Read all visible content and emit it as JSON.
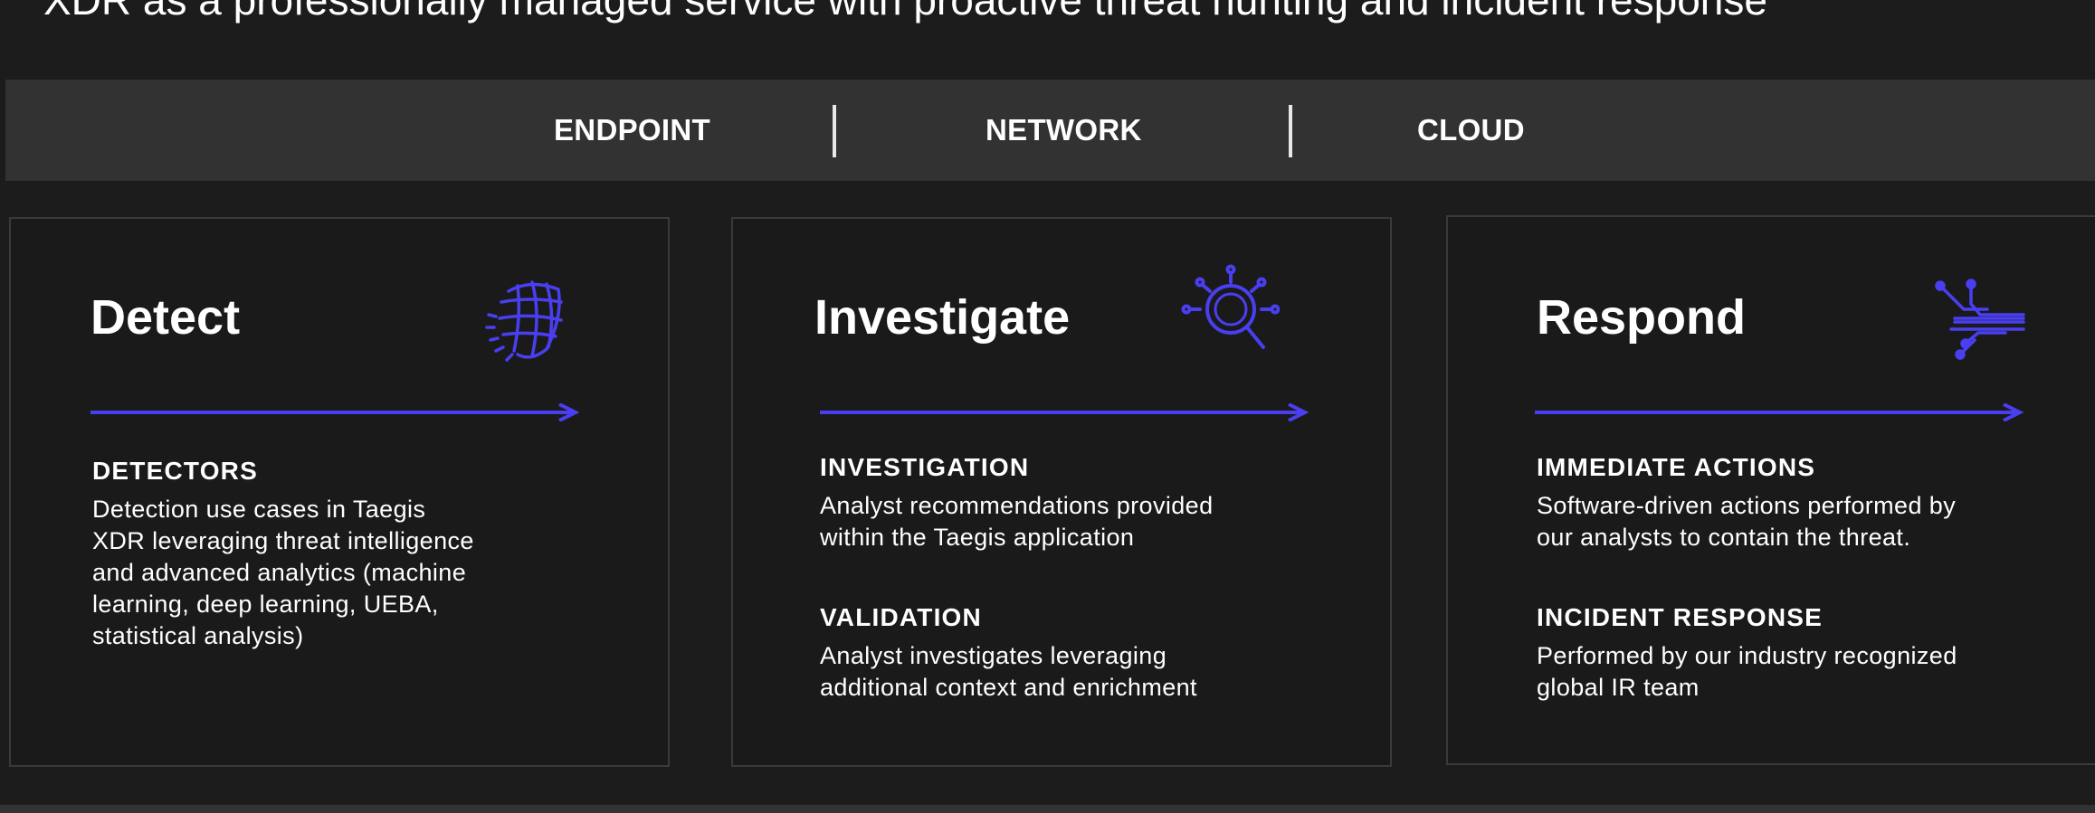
{
  "headline": "XDR as a professionally managed service with proactive threat hunting and incident response",
  "coverage": {
    "items": [
      "ENDPOINT",
      "NETWORK",
      "CLOUD"
    ]
  },
  "accent_color": "#4a3ff0",
  "cards": [
    {
      "title": "Detect",
      "icon": "globe-shield-icon",
      "sections": [
        {
          "heading": "DETECTORS",
          "body_lines": [
            "Detection use cases in Taegis",
            "XDR leveraging threat intelligence",
            "and advanced analytics (machine",
            "learning, deep learning, UEBA,",
            "statistical analysis)"
          ]
        }
      ]
    },
    {
      "title": "Investigate",
      "icon": "magnifier-icon",
      "sections": [
        {
          "heading": "INVESTIGATION",
          "body_lines": [
            "Analyst recommendations provided",
            "within the Taegis application"
          ]
        },
        {
          "heading": "VALIDATION",
          "body_lines": [
            "Analyst investigates leveraging",
            "additional context and enrichment"
          ]
        }
      ]
    },
    {
      "title": "Respond",
      "icon": "circuit-icon",
      "sections": [
        {
          "heading": "IMMEDIATE ACTIONS",
          "body_lines": [
            "Software-driven actions performed by",
            "our analysts to contain the threat."
          ]
        },
        {
          "heading": "INCIDENT RESPONSE",
          "body_lines": [
            "Performed by our industry recognized",
            "global IR team"
          ]
        }
      ]
    }
  ]
}
